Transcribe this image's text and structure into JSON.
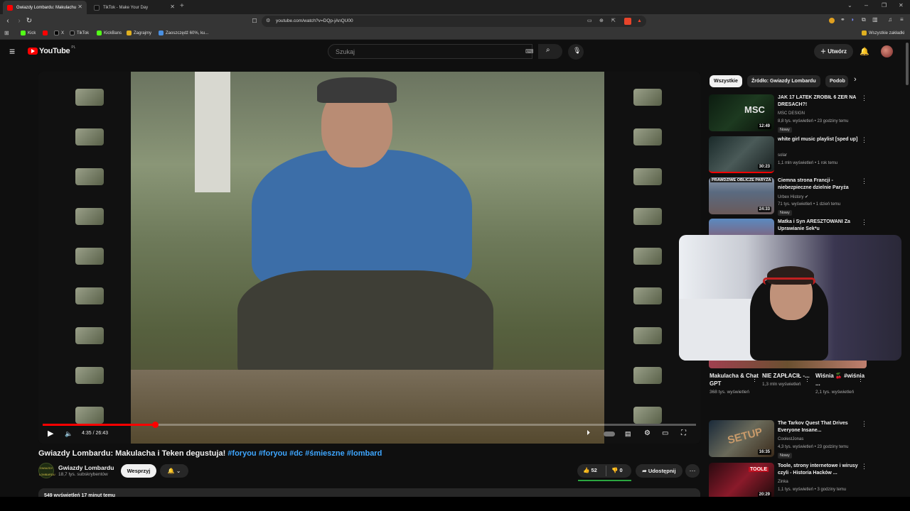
{
  "browser": {
    "tabs": [
      {
        "label": "Gwiazdy Lombardu: Makulachu",
        "active": true
      },
      {
        "label": "TikTok - Make Your Day",
        "active": false
      }
    ],
    "url": "youtube.com/watch?v=DQp-jAnQU00",
    "bookmarks": [
      "Kick",
      "X",
      "TikTok",
      "KickBans",
      "Zagrajmy",
      "Zaoszczędź 60%, ku..."
    ],
    "all_bookmarks": "Wszystkie zakładki"
  },
  "youtube": {
    "logo": "YouTube",
    "country": "PL",
    "search_placeholder": "Szukaj",
    "create_label": "Utwórz"
  },
  "player": {
    "time": "4:35 / 26:43",
    "progress_fraction": 0.1716
  },
  "video": {
    "title": "Gwiazdy Lombardu: Makulacha i Teken degustuja!",
    "tags": "#foryou #foryou #dc #śmieszne #lombard",
    "channel": "Gwiazdy Lombardu",
    "channel_avatar_text": "GWIAZDY LOMBARDU",
    "subscribers": "18,7 tys. subskrybentów",
    "subscribe_label": "Wesprzyj",
    "likes": "52",
    "dislikes": "0",
    "share_label": "Udostępnij",
    "description_line": "549 wyświetleń  17 minut temu"
  },
  "sidebar": {
    "chips": [
      "Wszystkie",
      "Źródło: Gwiazdy Lombardu",
      "Podob"
    ],
    "recommendations": [
      {
        "title": "JAK 17 LATEK ZROBIŁ 6 ZER NA DRESACH?!",
        "channel": "MSC DESIGN",
        "meta": "8,8 tys. wyświetleń • 23 godziny temu",
        "badge": "Nowy",
        "duration": "12:49",
        "thumb_text": "MSC"
      },
      {
        "title": "white girl music playlist [sped up]",
        "channel": "solar",
        "meta": "1,1 mln wyświetleń • 1 rok temu",
        "badge": "",
        "duration": "30:23",
        "thumb_text": ""
      },
      {
        "title": "Ciemna strona Francji - niebezpieczne dzielnie Paryża",
        "channel": "Urbex History",
        "meta": "71 tys. wyświetleń • 1 dzień temu",
        "badge": "Nowy",
        "duration": "24:33",
        "thumb_text": "PRAWDZIWE OBLICZE PARYŻA"
      },
      {
        "title": "Matka i Syn ARESZTOWANI Za Uprawianie Sek*u",
        "channel": "",
        "meta": "",
        "badge": "",
        "duration": "",
        "thumb_text": ""
      },
      {
        "title": "The Tarkov Quest That Drives Everyone Insane...",
        "channel": "CoolestJonas",
        "meta": "4,3 tys. wyświetleń • 23 godziny temu",
        "badge": "Nowy",
        "duration": "16:35",
        "thumb_text": "SETUP"
      },
      {
        "title": "Toole, strony internetowe i wirusy czyli - Historia Hacków ...",
        "channel": "Zinka",
        "meta": "1,1 tys. wyświetleń • 3 godziny temu",
        "badge": "",
        "duration": "20:29",
        "thumb_text": "TOOLE"
      }
    ],
    "shorts": [
      {
        "title": "Makulacha & Chat GPT",
        "views": "368 tys. wyświetleń"
      },
      {
        "title": "NIE ZAPŁACIŁ -...",
        "views": "1,3 mln wyświetleń"
      },
      {
        "title": "Wiśnia 🍒 #wiśnia ...",
        "views": "2,1 tys. wyświetleń"
      }
    ]
  },
  "colors": {
    "accent": "#ff0000",
    "link": "#3ea6ff",
    "bg": "#0f0f0f"
  }
}
